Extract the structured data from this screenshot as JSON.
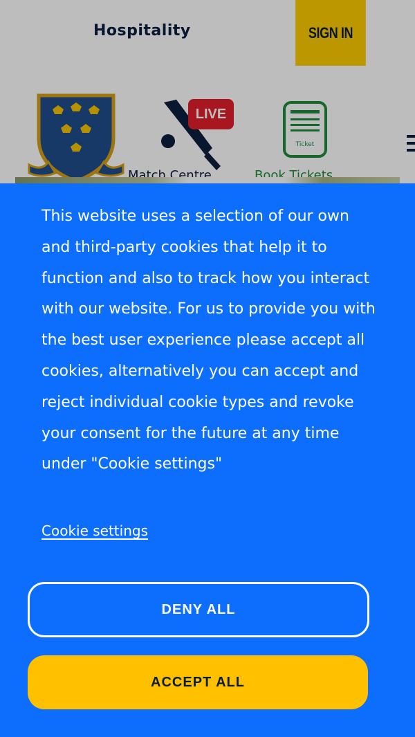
{
  "header": {
    "hospitality_label": "Hospitality",
    "signin_label": "SIGN IN",
    "live_badge": "LIVE",
    "match_centre_label": "Match Centre",
    "book_tickets_label": "Book Tickets",
    "ticket_icon_text": "Ticket"
  },
  "cookie_banner": {
    "message": "This website uses a selection of our own and third-party cookies that help it to function and also to track how you interact with our website. For us to provide you with the best user experience please accept all cookies, alternatively you can accept and reject individual cookie types and revoke your consent for the future at any time under \"Cookie settings\"",
    "settings_link": "Cookie settings",
    "deny_label": "DENY ALL",
    "accept_label": "ACCEPT ALL"
  },
  "colors": {
    "banner_background": "#0d6efd",
    "accept_button": "#ffc000",
    "signin_button": "#ffcc00",
    "live_badge": "#e31e2c",
    "navy": "#0b1e3f"
  }
}
